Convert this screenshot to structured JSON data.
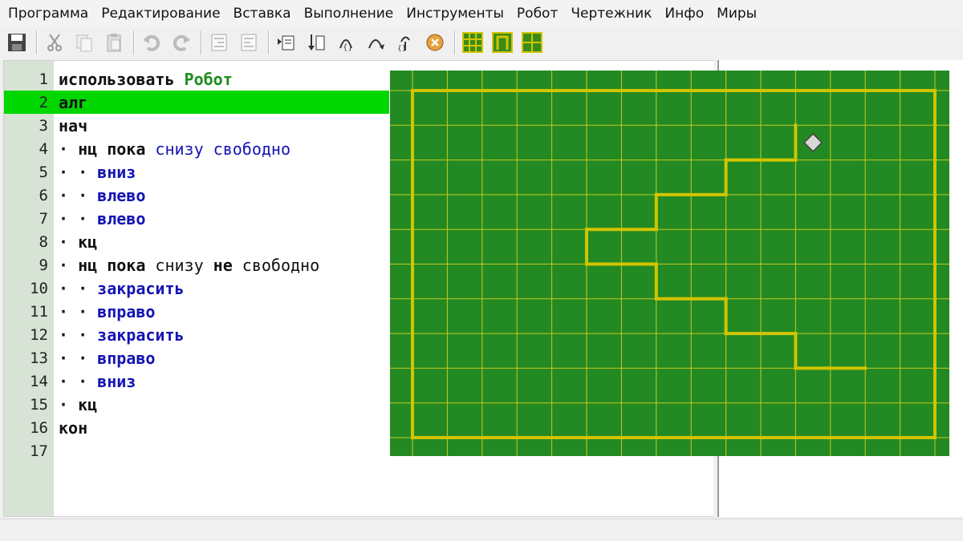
{
  "menu": [
    "Программа",
    "Редактирование",
    "Вставка",
    "Выполнение",
    "Инструменты",
    "Робот",
    "Чертежник",
    "Инфо",
    "Миры"
  ],
  "toolbar_icons": [
    "save-icon",
    "cut-icon",
    "copy-icon",
    "paste-icon",
    "undo-icon",
    "redo-icon",
    "indent-icon",
    "outdent-icon",
    "run-icon",
    "step-icon",
    "step-into-icon",
    "step-out-icon",
    "restart-icon",
    "stop-icon",
    "robot-field-icon",
    "robot-remote-icon",
    "robot-setup-icon"
  ],
  "editor": {
    "active_line": 2,
    "lines": [
      {
        "n": "1",
        "parts": [
          {
            "t": "использовать ",
            "c": "kw"
          },
          {
            "t": "Робот",
            "c": "robot"
          }
        ]
      },
      {
        "n": "2",
        "parts": [
          {
            "t": "алг",
            "c": "kw"
          }
        ]
      },
      {
        "n": "3",
        "parts": [
          {
            "t": "нач",
            "c": "kw"
          }
        ]
      },
      {
        "n": "4",
        "parts": [
          {
            "t": "· ",
            "c": "dots"
          },
          {
            "t": "нц пока ",
            "c": "kw"
          },
          {
            "t": "снизу свободно",
            "c": "cond"
          }
        ]
      },
      {
        "n": "5",
        "parts": [
          {
            "t": "· · ",
            "c": "dots"
          },
          {
            "t": "вниз",
            "c": "cmd"
          }
        ]
      },
      {
        "n": "6",
        "parts": [
          {
            "t": "· · ",
            "c": "dots"
          },
          {
            "t": "влево",
            "c": "cmd"
          }
        ]
      },
      {
        "n": "7",
        "parts": [
          {
            "t": "· · ",
            "c": "dots"
          },
          {
            "t": "влево",
            "c": "cmd"
          }
        ]
      },
      {
        "n": "8",
        "parts": [
          {
            "t": "· ",
            "c": "dots"
          },
          {
            "t": "кц",
            "c": "kw"
          }
        ]
      },
      {
        "n": "9",
        "parts": [
          {
            "t": "· ",
            "c": "dots"
          },
          {
            "t": "нц пока ",
            "c": "kw"
          },
          {
            "t": "снизу ",
            "c": "plain"
          },
          {
            "t": "не",
            "c": "kw"
          },
          {
            "t": " свободно",
            "c": "plain"
          }
        ]
      },
      {
        "n": "10",
        "parts": [
          {
            "t": "· · ",
            "c": "dots"
          },
          {
            "t": "закрасить",
            "c": "cmd"
          }
        ]
      },
      {
        "n": "11",
        "parts": [
          {
            "t": "· · ",
            "c": "dots"
          },
          {
            "t": "вправо",
            "c": "cmd"
          }
        ]
      },
      {
        "n": "12",
        "parts": [
          {
            "t": "· · ",
            "c": "dots"
          },
          {
            "t": "закрасить",
            "c": "cmd"
          }
        ]
      },
      {
        "n": "13",
        "parts": [
          {
            "t": "· · ",
            "c": "dots"
          },
          {
            "t": "вправо",
            "c": "cmd"
          }
        ]
      },
      {
        "n": "14",
        "parts": [
          {
            "t": "· · ",
            "c": "dots"
          },
          {
            "t": "вниз",
            "c": "cmd"
          }
        ]
      },
      {
        "n": "15",
        "parts": [
          {
            "t": "· ",
            "c": "dots"
          },
          {
            "t": "кц",
            "c": "kw"
          }
        ]
      },
      {
        "n": "16",
        "parts": [
          {
            "t": "кон",
            "c": "kw"
          }
        ]
      },
      {
        "n": "17",
        "parts": []
      }
    ]
  },
  "robot_field": {
    "columns": 15,
    "rows": 10,
    "background_color": "#238a23",
    "grid_color": "#c8c820",
    "wall_color": "#d2c400",
    "robot_color": "#d8d8d8",
    "robot_cell": {
      "col": 11,
      "row": 1
    },
    "walls": [
      [
        [
          11,
          1
        ],
        [
          11,
          2
        ]
      ],
      [
        [
          11,
          2
        ],
        [
          9,
          2
        ]
      ],
      [
        [
          9,
          2
        ],
        [
          9,
          3
        ]
      ],
      [
        [
          9,
          3
        ],
        [
          7,
          3
        ]
      ],
      [
        [
          7,
          3
        ],
        [
          7,
          4
        ]
      ],
      [
        [
          7,
          4
        ],
        [
          5,
          4
        ]
      ],
      [
        [
          5,
          4
        ],
        [
          5,
          5
        ]
      ],
      [
        [
          5,
          5
        ],
        [
          7,
          5
        ]
      ],
      [
        [
          7,
          5
        ],
        [
          7,
          6
        ]
      ],
      [
        [
          7,
          6
        ],
        [
          9,
          6
        ]
      ],
      [
        [
          9,
          6
        ],
        [
          9,
          7
        ]
      ],
      [
        [
          9,
          7
        ],
        [
          11,
          7
        ]
      ],
      [
        [
          11,
          7
        ],
        [
          11,
          8
        ]
      ],
      [
        [
          11,
          8
        ],
        [
          13,
          8
        ]
      ]
    ]
  }
}
